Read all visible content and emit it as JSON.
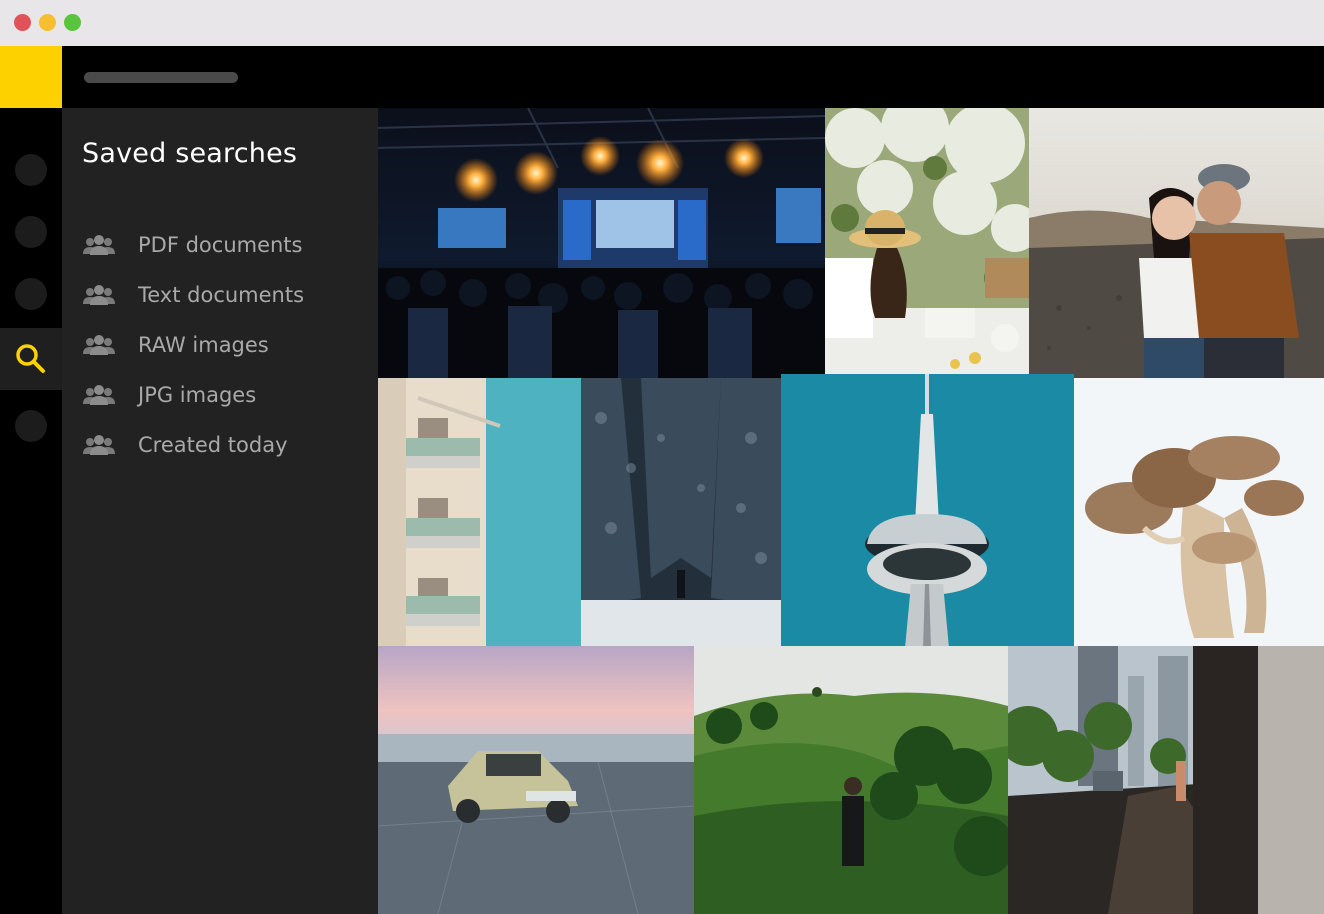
{
  "window": {
    "controls": {
      "close_color": "#e0535a",
      "minimize_color": "#f5bf2f",
      "maximize_color": "#5ac43c"
    }
  },
  "brand": {
    "accent": "#fdd100"
  },
  "topbar": {
    "search_pill": ""
  },
  "rail": {
    "items": [
      {
        "name": "rail-item-1",
        "active": false
      },
      {
        "name": "rail-item-2",
        "active": false
      },
      {
        "name": "rail-item-3",
        "active": false
      },
      {
        "name": "search",
        "active": true,
        "icon": "search-icon"
      },
      {
        "name": "rail-item-5",
        "active": false
      }
    ]
  },
  "sidebar": {
    "title": "Saved searches",
    "items": [
      {
        "label": "PDF documents",
        "icon": "users-icon"
      },
      {
        "label": "Text documents",
        "icon": "users-icon"
      },
      {
        "label": "RAW images",
        "icon": "users-icon"
      },
      {
        "label": "JPG images",
        "icon": "users-icon"
      },
      {
        "label": "Created today",
        "icon": "users-icon"
      }
    ]
  },
  "gallery": {
    "photos": [
      {
        "subject": "concert-stage"
      },
      {
        "subject": "picnic-woman"
      },
      {
        "subject": "couple-embrace"
      },
      {
        "subject": "building-balconies"
      },
      {
        "subject": "snowy-forest"
      },
      {
        "subject": "cn-tower"
      },
      {
        "subject": "mushroom"
      },
      {
        "subject": "car-rooftop"
      },
      {
        "subject": "green-hills"
      },
      {
        "subject": "city-street"
      }
    ]
  }
}
